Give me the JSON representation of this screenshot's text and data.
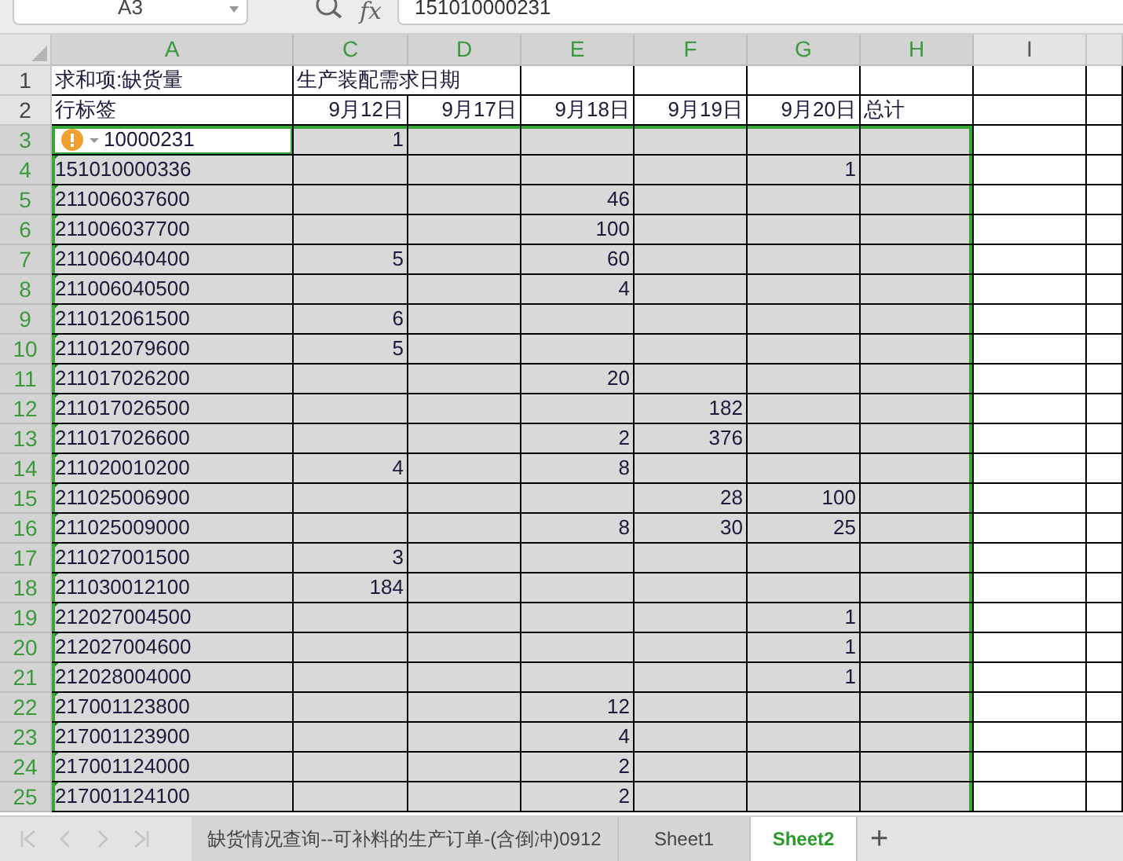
{
  "name_box": "A3",
  "formula_label": "fx",
  "formula": "151010000231",
  "columns": [
    {
      "letter": "A",
      "selected": true
    },
    {
      "letter": "C",
      "selected": true
    },
    {
      "letter": "D",
      "selected": true
    },
    {
      "letter": "E",
      "selected": true
    },
    {
      "letter": "F",
      "selected": true
    },
    {
      "letter": "G",
      "selected": true
    },
    {
      "letter": "H",
      "selected": true
    },
    {
      "letter": "I",
      "selected": false
    },
    {
      "selected": false
    }
  ],
  "rows": [
    {
      "number": "1",
      "kind": "title",
      "selected": false,
      "flagged": false,
      "active": false,
      "cells": [
        "求和项:缺货量",
        "生产装配需求日期",
        "",
        "",
        "",
        "",
        "",
        "",
        ""
      ]
    },
    {
      "number": "2",
      "kind": "dates",
      "selected": false,
      "flagged": false,
      "active": false,
      "cells": [
        "行标签",
        "9月12日",
        "9月17日",
        "9月18日",
        "9月19日",
        "9月20日",
        "总计",
        "",
        ""
      ]
    },
    {
      "number": "3",
      "kind": "data",
      "selected": true,
      "flagged": true,
      "active": true,
      "warning": true,
      "cells": [
        "10000231",
        "1",
        "",
        "",
        "",
        "",
        "",
        "",
        ""
      ]
    },
    {
      "number": "4",
      "kind": "data",
      "selected": true,
      "flagged": true,
      "active": false,
      "cells": [
        "151010000336",
        "",
        "",
        "",
        "",
        "1",
        "",
        "",
        ""
      ]
    },
    {
      "number": "5",
      "kind": "data",
      "selected": true,
      "flagged": true,
      "active": false,
      "cells": [
        "211006037600",
        "",
        "",
        "46",
        "",
        "",
        "",
        "",
        ""
      ]
    },
    {
      "number": "6",
      "kind": "data",
      "selected": true,
      "flagged": true,
      "active": false,
      "cells": [
        "211006037700",
        "",
        "",
        "100",
        "",
        "",
        "",
        "",
        ""
      ]
    },
    {
      "number": "7",
      "kind": "data",
      "selected": true,
      "flagged": true,
      "active": false,
      "cells": [
        "211006040400",
        "5",
        "",
        "60",
        "",
        "",
        "",
        "",
        ""
      ]
    },
    {
      "number": "8",
      "kind": "data",
      "selected": true,
      "flagged": true,
      "active": false,
      "cells": [
        "211006040500",
        "",
        "",
        "4",
        "",
        "",
        "",
        "",
        ""
      ]
    },
    {
      "number": "9",
      "kind": "data",
      "selected": true,
      "flagged": true,
      "active": false,
      "cells": [
        "211012061500",
        "6",
        "",
        "",
        "",
        "",
        "",
        "",
        ""
      ]
    },
    {
      "number": "10",
      "kind": "data",
      "selected": true,
      "flagged": true,
      "active": false,
      "cells": [
        "211012079600",
        "5",
        "",
        "",
        "",
        "",
        "",
        "",
        ""
      ]
    },
    {
      "number": "11",
      "kind": "data",
      "selected": true,
      "flagged": true,
      "active": false,
      "cells": [
        "211017026200",
        "",
        "",
        "20",
        "",
        "",
        "",
        "",
        ""
      ]
    },
    {
      "number": "12",
      "kind": "data",
      "selected": true,
      "flagged": true,
      "active": false,
      "cells": [
        "211017026500",
        "",
        "",
        "",
        "182",
        "",
        "",
        "",
        ""
      ]
    },
    {
      "number": "13",
      "kind": "data",
      "selected": true,
      "flagged": true,
      "active": false,
      "cells": [
        "211017026600",
        "",
        "",
        "2",
        "376",
        "",
        "",
        "",
        ""
      ]
    },
    {
      "number": "14",
      "kind": "data",
      "selected": true,
      "flagged": true,
      "active": false,
      "cells": [
        "211020010200",
        "4",
        "",
        "8",
        "",
        "",
        "",
        "",
        ""
      ]
    },
    {
      "number": "15",
      "kind": "data",
      "selected": true,
      "flagged": true,
      "active": false,
      "cells": [
        "211025006900",
        "",
        "",
        "",
        "28",
        "100",
        "",
        "",
        ""
      ]
    },
    {
      "number": "16",
      "kind": "data",
      "selected": true,
      "flagged": true,
      "active": false,
      "cells": [
        "211025009000",
        "",
        "",
        "8",
        "30",
        "25",
        "",
        "",
        ""
      ]
    },
    {
      "number": "17",
      "kind": "data",
      "selected": true,
      "flagged": true,
      "active": false,
      "cells": [
        "211027001500",
        "3",
        "",
        "",
        "",
        "",
        "",
        "",
        ""
      ]
    },
    {
      "number": "18",
      "kind": "data",
      "selected": true,
      "flagged": true,
      "active": false,
      "cells": [
        "211030012100",
        "184",
        "",
        "",
        "",
        "",
        "",
        "",
        ""
      ]
    },
    {
      "number": "19",
      "kind": "data",
      "selected": true,
      "flagged": true,
      "active": false,
      "cells": [
        "212027004500",
        "",
        "",
        "",
        "",
        "1",
        "",
        "",
        ""
      ]
    },
    {
      "number": "20",
      "kind": "data",
      "selected": true,
      "flagged": true,
      "active": false,
      "cells": [
        "212027004600",
        "",
        "",
        "",
        "",
        "1",
        "",
        "",
        ""
      ]
    },
    {
      "number": "21",
      "kind": "data",
      "selected": true,
      "flagged": true,
      "active": false,
      "cells": [
        "212028004000",
        "",
        "",
        "",
        "",
        "1",
        "",
        "",
        ""
      ]
    },
    {
      "number": "22",
      "kind": "data",
      "selected": true,
      "flagged": true,
      "active": false,
      "cells": [
        "217001123800",
        "",
        "",
        "12",
        "",
        "",
        "",
        "",
        ""
      ]
    },
    {
      "number": "23",
      "kind": "data",
      "selected": true,
      "flagged": true,
      "active": false,
      "cells": [
        "217001123900",
        "",
        "",
        "4",
        "",
        "",
        "",
        "",
        ""
      ]
    },
    {
      "number": "24",
      "kind": "data",
      "selected": true,
      "flagged": true,
      "active": false,
      "cells": [
        "217001124000",
        "",
        "",
        "2",
        "",
        "",
        "",
        "",
        ""
      ]
    },
    {
      "number": "25",
      "kind": "data",
      "selected": true,
      "flagged": true,
      "active": false,
      "cells": [
        "217001124100",
        "",
        "",
        "2",
        "",
        "",
        "",
        "",
        ""
      ]
    }
  ],
  "sheet_tabs": [
    {
      "label": "缺货情况查询--可补料的生产订单-(含倒冲)0912",
      "selected": false
    },
    {
      "label": "Sheet1",
      "selected": false
    },
    {
      "label": "Sheet2",
      "selected": true
    }
  ],
  "add_sheet": "+"
}
